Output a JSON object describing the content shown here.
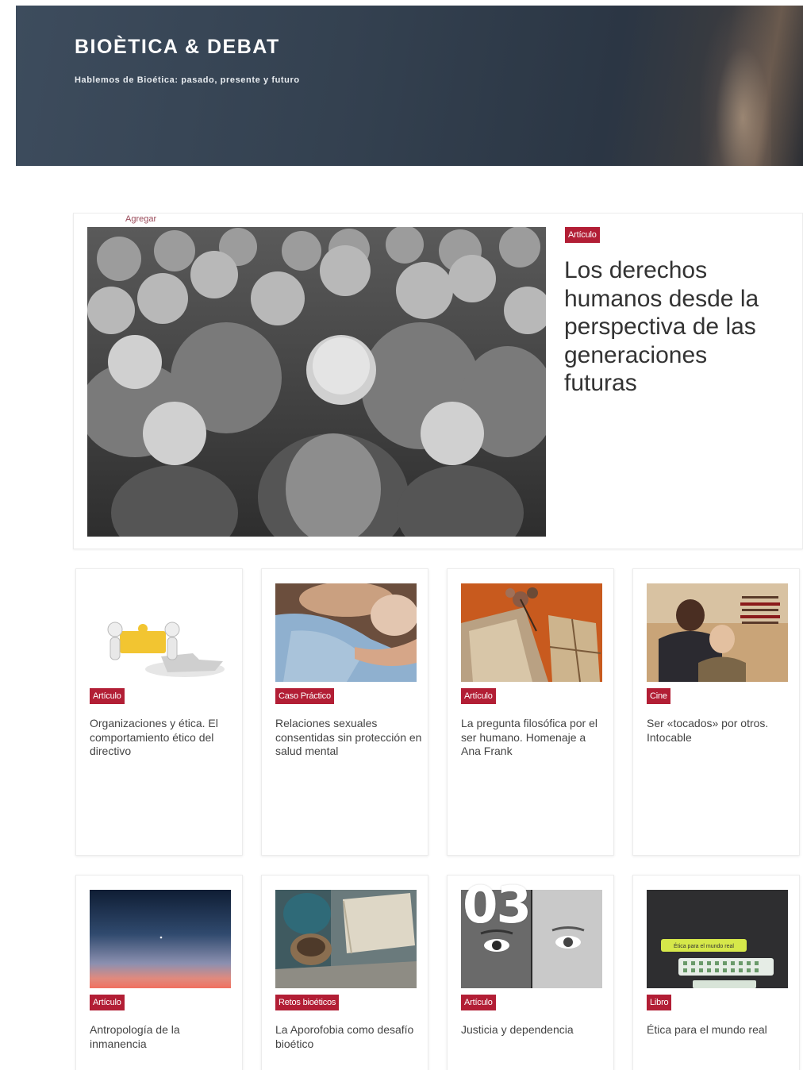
{
  "site": {
    "title": "BIOÈTICA & DEBAT",
    "subtitle": "Hablemos de Bioética: pasado, presente y futuro"
  },
  "featured": {
    "add_link": "Agregar",
    "tag": "Artículo",
    "title": "Los derechos humanos desde la perspectiva de las generaciones futuras",
    "image": "crowd-photo"
  },
  "cards_row1": [
    {
      "tag": "Artículo",
      "title": "Organizaciones y ética. El comportamiento ético del directivo",
      "image": "puzzle-illustration"
    },
    {
      "tag": "Caso Práctico",
      "title": "Relaciones sexuales consentidas sin protección en salud mental",
      "image": "couple-photo"
    },
    {
      "tag": "Artículo",
      "title": "La pregunta filosófica por el ser humano. Homenaje a Ana Frank",
      "image": "letters-photo"
    },
    {
      "tag": "Cine",
      "title": "Ser «tocados» por otros. Intocable",
      "image": "movie-poster"
    }
  ],
  "cards_row2": [
    {
      "tag": "Artículo",
      "title": "Antropología de la inmanencia",
      "image": "sky-gradient"
    },
    {
      "tag": "Retos bioéticos",
      "title": "La Aporofobia como desafío bioético",
      "image": "help-sign-photo"
    },
    {
      "tag": "Artículo",
      "title": "Justicia y dependencia",
      "image": "faces-photo"
    },
    {
      "tag": "Libro",
      "title": "Ética para el mundo real",
      "image": "book-cover"
    }
  ],
  "book_cover": {
    "banner": "Ética para el mundo real"
  },
  "overlay": {
    "text": "03"
  },
  "colors": {
    "tag": "#b21e35",
    "header": "#33404f",
    "link": "#9a4b5a"
  }
}
